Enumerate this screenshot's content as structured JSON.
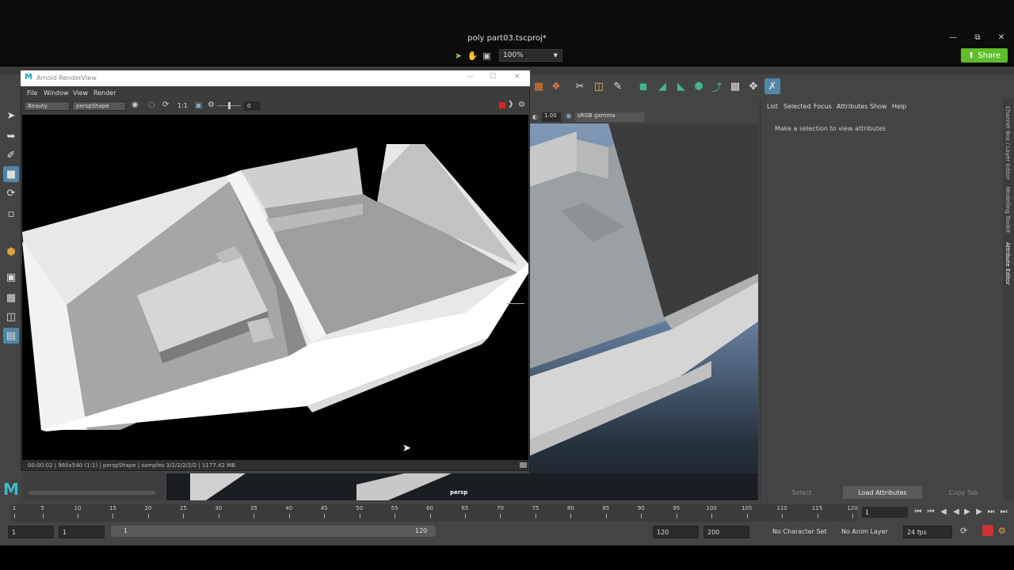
{
  "camtasia": {
    "title": "poly part03.tscproj*",
    "zoom": "100%",
    "share_label": "Share"
  },
  "arnold": {
    "title": "Arnold RenderView",
    "menu": [
      "File",
      "Window",
      "View",
      "Render"
    ],
    "aov": "Beauty",
    "camera": "perspShape",
    "ratio": "1:1",
    "exposure": "0",
    "status": "00:00:02 | 960x540 (1:1) | perspShape | samples 3/2/2/2/2/2 | 1177.42 MB"
  },
  "viewport": {
    "gamma_value": "1.00",
    "colorspace": "sRGB gamma",
    "camera_label": "persp"
  },
  "attribute_editor": {
    "menu": [
      "List",
      "Selected",
      "Focus",
      "Attributes",
      "Show",
      "Help"
    ],
    "empty_message": "Make a selection to view attributes",
    "buttons": [
      "Select",
      "Load Attributes",
      "Copy Tab"
    ],
    "side_tabs": [
      "Channel Box / Layer Editor",
      "Modelling Toolkit",
      "Attribute Editor"
    ]
  },
  "timeline": {
    "ticks": [
      "1",
      "5",
      "10",
      "15",
      "20",
      "25",
      "30",
      "35",
      "40",
      "45",
      "50",
      "55",
      "60",
      "65",
      "70",
      "75",
      "80",
      "85",
      "90",
      "95",
      "100",
      "105",
      "110",
      "115",
      "120"
    ],
    "current_frame": "1"
  },
  "range": {
    "start": "1",
    "anim_start": "1",
    "slider_start": "1",
    "slider_end": "120",
    "anim_end": "120",
    "end": "200",
    "character_set": "No Character Set",
    "anim_layer": "No Anim Layer",
    "fps": "24 fps"
  },
  "colors": {
    "maya_bg": "#444444",
    "accent": "#5285a6",
    "share_green": "#5fbf2a",
    "shelf_green": "#3fb88a"
  }
}
